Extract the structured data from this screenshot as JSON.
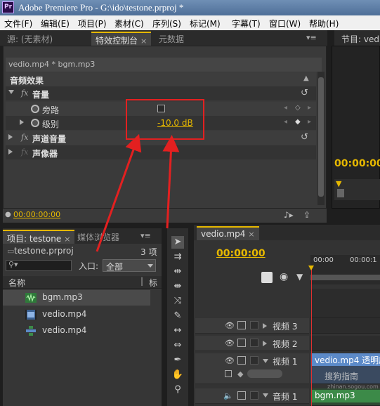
{
  "window": {
    "title": "Adobe Premiere Pro - G:\\ido\\testone.prproj *",
    "logo": "Pr"
  },
  "menu": [
    "文件(F)",
    "编辑(E)",
    "项目(P)",
    "素材(C)",
    "序列(S)",
    "标记(M)",
    "字幕(T)",
    "窗口(W)",
    "帮助(H)"
  ],
  "top_tabs": {
    "source": "源: (无素材)",
    "effect_controls": "特效控制台",
    "metadata": "元数据",
    "program": "节目: ved"
  },
  "effect_controls": {
    "clip_header": "vedio.mp4 * bgm.mp3",
    "section": "音频效果",
    "rows": [
      {
        "fx": "fx",
        "label": "音量"
      },
      {
        "label": "旁路"
      },
      {
        "label": "级别",
        "value": "-10.0 dB"
      },
      {
        "fx": "fx",
        "label": "声道音量"
      },
      {
        "fx": "fx",
        "label": "声像器"
      }
    ],
    "timecode": "00:00:00:00"
  },
  "program": {
    "timecode": "00:00:00:"
  },
  "project": {
    "tab": "项目: testone",
    "browser_tab": "媒体浏览器",
    "name": "testone.prproj",
    "count": "3 项",
    "entry_label": "入口:",
    "entry_value": "全部",
    "col_name": "名称",
    "col_label": "标",
    "items": [
      {
        "name": "bgm.mp3",
        "icon": "audio-file-icon"
      },
      {
        "name": "vedio.mp4",
        "icon": "video-file-icon"
      },
      {
        "name": "vedio.mp4",
        "icon": "sequence-icon"
      }
    ]
  },
  "timeline": {
    "tab": "vedio.mp4",
    "timecode": "00:00:00",
    "ruler": [
      "00:00",
      "00:00:1"
    ],
    "tracks": [
      {
        "name": "视频 3"
      },
      {
        "name": "视频 2"
      },
      {
        "name": "视频 1",
        "clip": "vedio.mp4",
        "clip_extra": "透明度"
      },
      {
        "name": "音频 1",
        "clip": "bgm.mp3"
      }
    ]
  },
  "watermark": {
    "text": "搜狗指南",
    "url": "zhinan.sogou.com"
  },
  "colors": {
    "accent": "#e6b800",
    "annotation": "#e32020",
    "video_clip": "#5c8ac8",
    "audio_clip": "#3c8a48"
  }
}
